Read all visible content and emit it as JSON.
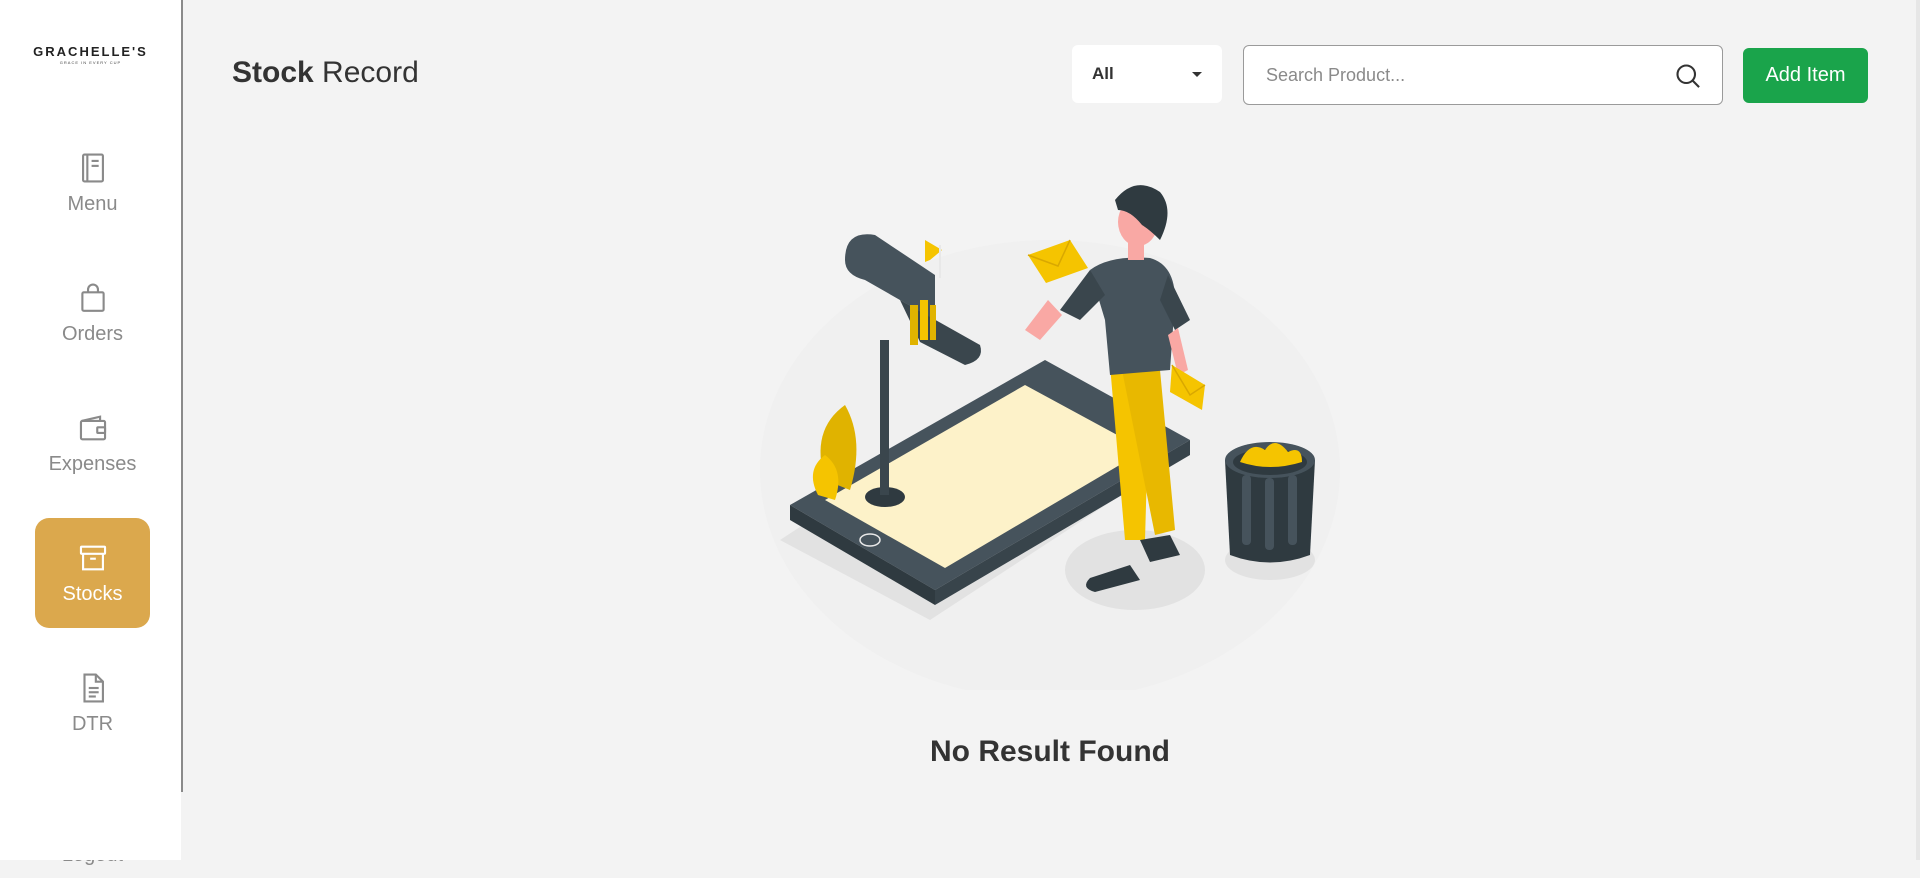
{
  "brand": {
    "name": "GRACHELLE'S",
    "tagline": "GRACE IN EVERY CUP"
  },
  "sidebar": {
    "items": [
      {
        "label": "Menu",
        "icon": "menu-book-icon",
        "active": false
      },
      {
        "label": "Orders",
        "icon": "shopping-bag-icon",
        "active": false
      },
      {
        "label": "Expenses",
        "icon": "wallet-icon",
        "active": false
      },
      {
        "label": "Stocks",
        "icon": "archive-box-icon",
        "active": true
      },
      {
        "label": "DTR",
        "icon": "document-icon",
        "active": false
      },
      {
        "label": "Logout",
        "icon": "logout-icon",
        "active": false
      }
    ]
  },
  "header": {
    "title_bold": "Stock",
    "title_rest": " Record",
    "filter": {
      "selected": "All"
    },
    "search": {
      "placeholder": "Search Product...",
      "value": ""
    },
    "add_button": "Add Item"
  },
  "empty_state": {
    "message": "No Result Found"
  },
  "colors": {
    "active_nav": "#dba84d",
    "add_button": "#1aa44b",
    "background": "#f3f3f3"
  }
}
